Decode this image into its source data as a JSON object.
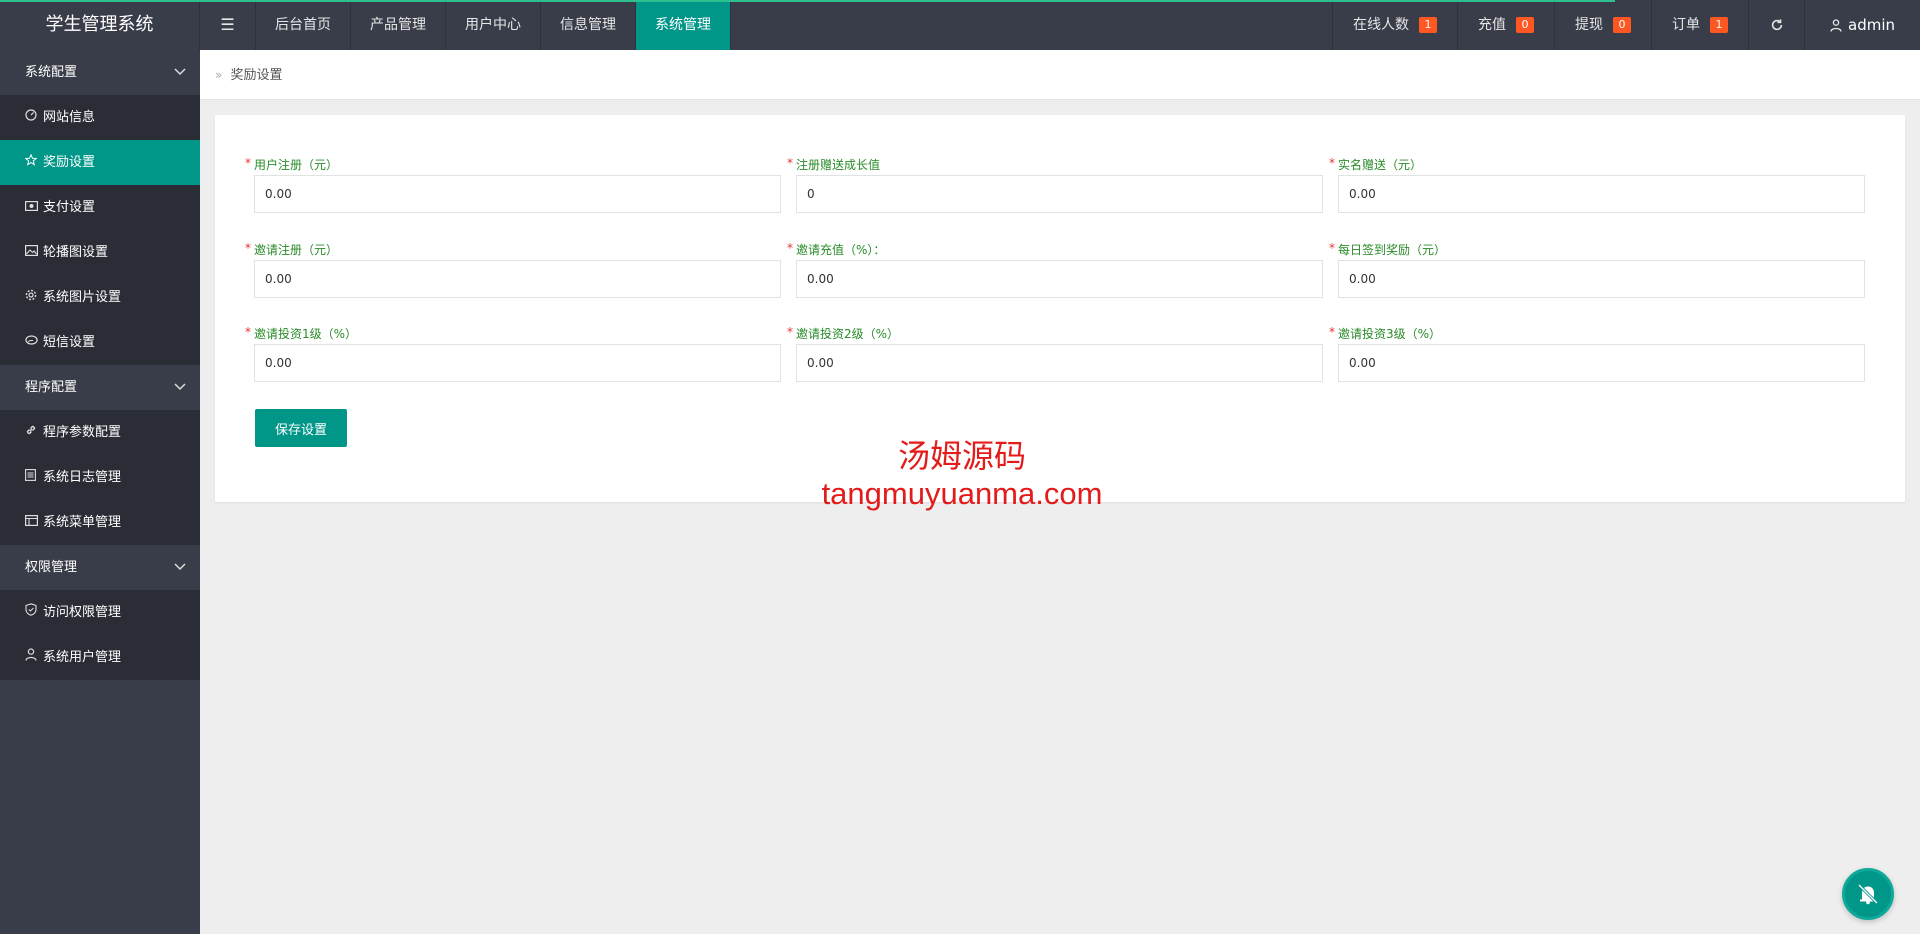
{
  "app": {
    "title": "学生管理系统"
  },
  "header": {
    "toggle_icon": "☰",
    "nav": [
      {
        "label": "后台首页"
      },
      {
        "label": "产品管理"
      },
      {
        "label": "用户中心"
      },
      {
        "label": "信息管理"
      },
      {
        "label": "系统管理",
        "active": true
      }
    ],
    "right": {
      "online": {
        "label": "在线人数",
        "count": "1"
      },
      "recharge": {
        "label": "充值",
        "count": "0"
      },
      "withdraw": {
        "label": "提现",
        "count": "0"
      },
      "orders": {
        "label": "订单",
        "count": "1"
      },
      "refresh_icon": "refresh-icon",
      "user": {
        "name": "admin",
        "icon": "user-icon"
      }
    }
  },
  "sidebar": {
    "groups": [
      {
        "label": "系统配置",
        "items": [
          {
            "label": "网站信息",
            "icon": "dashboard-icon"
          },
          {
            "label": "奖励设置",
            "icon": "star-icon",
            "active": true
          },
          {
            "label": "支付设置",
            "icon": "money-icon"
          },
          {
            "label": "轮播图设置",
            "icon": "picture-icon"
          },
          {
            "label": "系统图片设置",
            "icon": "gear-icon"
          },
          {
            "label": "短信设置",
            "icon": "chat-icon"
          }
        ]
      },
      {
        "label": "程序配置",
        "items": [
          {
            "label": "程序参数配置",
            "icon": "link-icon"
          },
          {
            "label": "系统日志管理",
            "icon": "log-icon"
          },
          {
            "label": "系统菜单管理",
            "icon": "menu-icon"
          }
        ]
      },
      {
        "label": "权限管理",
        "items": [
          {
            "label": "访问权限管理",
            "icon": "shield-icon"
          },
          {
            "label": "系统用户管理",
            "icon": "user-icon"
          }
        ]
      }
    ]
  },
  "breadcrumb": {
    "current": "奖励设置"
  },
  "form": {
    "fields": [
      {
        "label": "用户注册（元）",
        "value": "0.00"
      },
      {
        "label": "注册赠送成长值",
        "value": "0"
      },
      {
        "label": "实名赠送（元）",
        "value": "0.00"
      },
      {
        "label": "邀请注册（元）",
        "value": "0.00"
      },
      {
        "label": "邀请充值（%）：",
        "value": "0.00"
      },
      {
        "label": "每日签到奖励（元）",
        "value": "0.00"
      },
      {
        "label": "邀请投资1级（%）",
        "value": "0.00"
      },
      {
        "label": "邀请投资2级（%）",
        "value": "0.00"
      },
      {
        "label": "邀请投资3级（%）",
        "value": "0.00"
      }
    ],
    "required_mark": "*",
    "save_label": "保存设置"
  },
  "watermark": {
    "cn": "汤姆源码",
    "en": "tangmuyuanma.com"
  },
  "colors": {
    "accent": "#009688",
    "header_bg": "#393d49",
    "sidebar_sub_bg": "#2a2d36",
    "badge": "#ff5722",
    "label_green": "#2a8b2a",
    "watermark_red": "#e31b1b"
  }
}
